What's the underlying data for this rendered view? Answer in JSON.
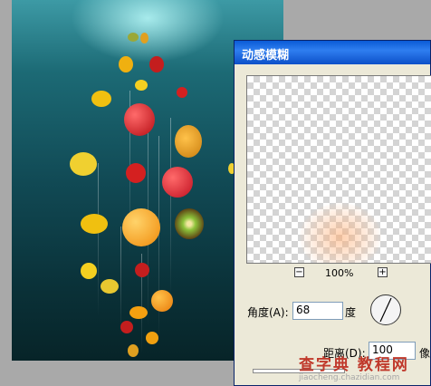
{
  "dialog": {
    "title": "动感模糊",
    "zoom_level": "100%",
    "zoom_out_label": "−",
    "zoom_in_label": "+",
    "angle_label": "角度(A):",
    "angle_value": "68",
    "angle_unit": "度",
    "distance_label": "距离(D):",
    "distance_value": "100",
    "distance_unit": "像"
  },
  "watermark": {
    "line1": "查字典 教程网",
    "line2": "jiaocheng.chazidian.com"
  },
  "colors": {
    "title_bar": "#0a5bd6",
    "dialog_bg": "#ece9d8",
    "workspace_bg": "#a9a9a9",
    "underwater": "#114a55"
  }
}
